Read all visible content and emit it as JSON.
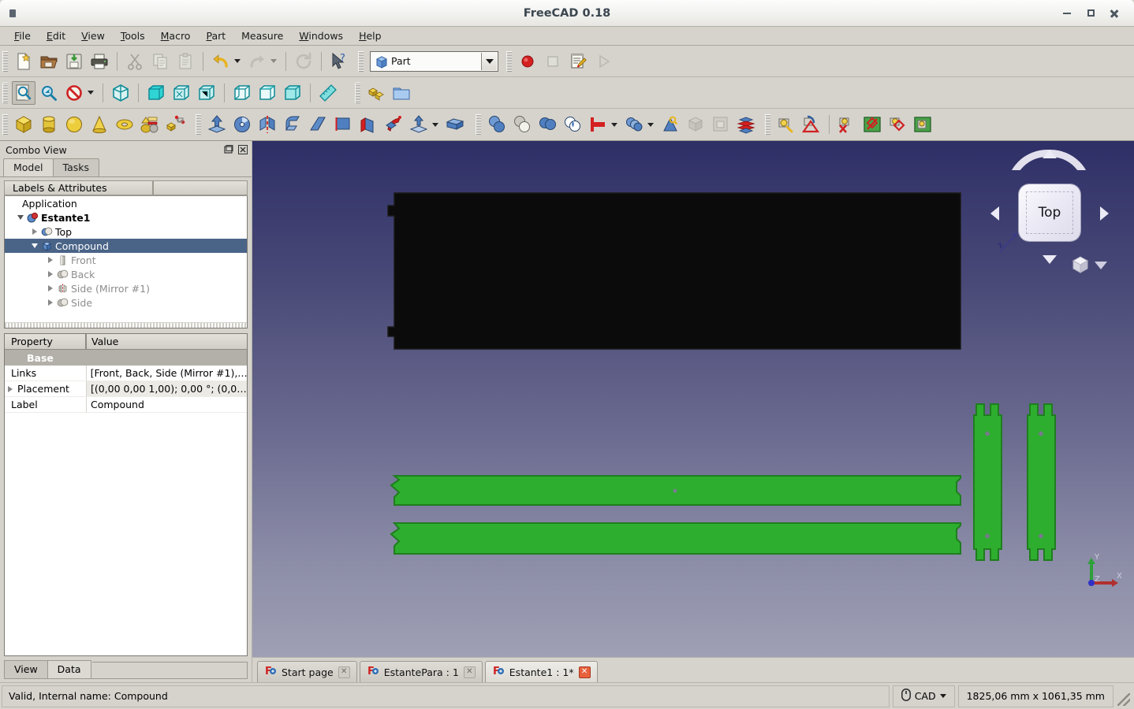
{
  "window": {
    "title": "FreeCAD 0.18",
    "minimize_label": "Minimize",
    "maximize_label": "Maximize",
    "close_label": "Close"
  },
  "menubar": {
    "items": [
      {
        "label": "File",
        "mnemonic": "F"
      },
      {
        "label": "Edit",
        "mnemonic": "E"
      },
      {
        "label": "View",
        "mnemonic": "V"
      },
      {
        "label": "Tools",
        "mnemonic": "T"
      },
      {
        "label": "Macro",
        "mnemonic": "M"
      },
      {
        "label": "Part",
        "mnemonic": "P"
      },
      {
        "label": "Measure",
        "mnemonic": ""
      },
      {
        "label": "Windows",
        "mnemonic": "W"
      },
      {
        "label": "Help",
        "mnemonic": "H"
      }
    ]
  },
  "toolbars": {
    "file": [
      {
        "name": "new-document-icon",
        "title": "New"
      },
      {
        "name": "open-document-icon",
        "title": "Open"
      },
      {
        "name": "save-document-icon",
        "title": "Save"
      },
      {
        "name": "print-icon",
        "title": "Print"
      },
      {
        "name": "cut-icon",
        "title": "Cut"
      },
      {
        "name": "copy-icon",
        "title": "Copy"
      },
      {
        "name": "paste-icon",
        "title": "Paste"
      },
      {
        "name": "undo-icon",
        "title": "Undo"
      },
      {
        "name": "redo-icon",
        "title": "Redo"
      },
      {
        "name": "refresh-icon",
        "title": "Refresh"
      },
      {
        "name": "whats-this-icon",
        "title": "What's this?"
      }
    ],
    "workbench": {
      "selected": "Part",
      "icon": "part-workbench-icon",
      "options": [
        "Part"
      ]
    },
    "macro": [
      {
        "name": "macro-record-icon",
        "title": "Macro recording"
      },
      {
        "name": "macro-stop-icon",
        "title": "Stop macro recording"
      },
      {
        "name": "macros-icon",
        "title": "Macros"
      },
      {
        "name": "macro-execute-icon",
        "title": "Execute macro"
      }
    ],
    "view": [
      {
        "name": "fit-all-icon",
        "title": "Fit all"
      },
      {
        "name": "fit-selection-icon",
        "title": "Fit selection"
      },
      {
        "name": "draw-style-icon",
        "title": "Draw style"
      },
      {
        "name": "isometric-view-icon",
        "title": "Axonometric"
      },
      {
        "name": "front-view-icon",
        "title": "Front"
      },
      {
        "name": "top-view-icon",
        "title": "Top"
      },
      {
        "name": "right-view-icon",
        "title": "Right"
      },
      {
        "name": "rear-view-icon",
        "title": "Rear"
      },
      {
        "name": "bottom-view-icon",
        "title": "Bottom"
      },
      {
        "name": "left-view-icon",
        "title": "Left"
      },
      {
        "name": "measure-icon",
        "title": "Measure"
      }
    ],
    "structure": [
      {
        "name": "create-part-icon",
        "title": "Create part"
      },
      {
        "name": "create-group-icon",
        "title": "Create group"
      }
    ],
    "primitives": [
      {
        "name": "box-icon",
        "title": "Cube"
      },
      {
        "name": "cylinder-icon",
        "title": "Cylinder"
      },
      {
        "name": "sphere-icon",
        "title": "Sphere"
      },
      {
        "name": "cone-icon",
        "title": "Cone"
      },
      {
        "name": "torus-icon",
        "title": "Torus"
      },
      {
        "name": "primitives-icon",
        "title": "Create primitives"
      },
      {
        "name": "shape-builder-icon",
        "title": "Shape builder"
      }
    ],
    "part_tools": [
      {
        "name": "extrude-icon",
        "title": "Extrude"
      },
      {
        "name": "revolve-icon",
        "title": "Revolve"
      },
      {
        "name": "mirror-icon",
        "title": "Mirror"
      },
      {
        "name": "fillet-icon",
        "title": "Fillet"
      },
      {
        "name": "chamfer-icon",
        "title": "Chamfer"
      },
      {
        "name": "ruled-surface-icon",
        "title": "Ruled surface"
      },
      {
        "name": "loft-icon",
        "title": "Loft"
      },
      {
        "name": "sweep-icon",
        "title": "Sweep"
      },
      {
        "name": "section-icon",
        "title": "Section"
      },
      {
        "name": "offset-icon",
        "title": "3D offset"
      },
      {
        "name": "thickness-icon",
        "title": "Thickness"
      }
    ],
    "boolean": [
      {
        "name": "boolean-icon",
        "title": "Boolean"
      },
      {
        "name": "cut-shape-icon",
        "title": "Cut"
      },
      {
        "name": "union-icon",
        "title": "Union"
      },
      {
        "name": "common-icon",
        "title": "Intersection"
      },
      {
        "name": "join-connect-icon",
        "title": "Join objects"
      },
      {
        "name": "split-icon",
        "title": "Split objects"
      },
      {
        "name": "compound-filter-icon",
        "title": "Compound filter"
      },
      {
        "name": "check-geometry-icon",
        "title": "Check geometry"
      },
      {
        "name": "defeaturing-icon",
        "title": "Defeaturing"
      },
      {
        "name": "cross-sections-icon",
        "title": "Cross-sections"
      }
    ],
    "measure": [
      {
        "name": "measure-linear-icon",
        "title": "Measure linear"
      },
      {
        "name": "measure-angular-icon",
        "title": "Measure angular"
      },
      {
        "name": "measure-refresh-icon",
        "title": "Refresh measure"
      },
      {
        "name": "measure-clear-all-icon",
        "title": "Clear all"
      },
      {
        "name": "measure-toggle-all-icon",
        "title": "Toggle all"
      },
      {
        "name": "measure-toggle-3d-icon",
        "title": "Toggle 3D"
      },
      {
        "name": "measure-toggle-delta-icon",
        "title": "Toggle delta"
      }
    ]
  },
  "combo_view": {
    "title": "Combo View",
    "float_button": "float-panel-icon",
    "close_button": "close-panel-icon",
    "tabs": [
      {
        "label": "Model",
        "active": true
      },
      {
        "label": "Tasks",
        "active": false
      }
    ],
    "tree_header": "Labels & Attributes",
    "tree": [
      {
        "label": "Application",
        "indent": 0,
        "icon": "",
        "expander": "none",
        "state": "normal"
      },
      {
        "label": "Estante1",
        "indent": 1,
        "icon": "document-icon",
        "expander": "open",
        "state": "bold"
      },
      {
        "label": "Top",
        "indent": 2,
        "icon": "fusion-icon",
        "expander": "closed",
        "state": "normal"
      },
      {
        "label": "Compound",
        "indent": 2,
        "icon": "compound-icon",
        "expander": "open",
        "state": "selected"
      },
      {
        "label": "Front",
        "indent": 3,
        "icon": "extrude-shape-icon",
        "expander": "closed",
        "state": "dim"
      },
      {
        "label": "Back",
        "indent": 3,
        "icon": "fusion-icon",
        "expander": "closed",
        "state": "dim"
      },
      {
        "label": "Side (Mirror #1)",
        "indent": 3,
        "icon": "mirror-shape-icon",
        "expander": "closed",
        "state": "dim"
      },
      {
        "label": "Side",
        "indent": 3,
        "icon": "fusion-icon",
        "expander": "closed",
        "state": "dim"
      }
    ],
    "property_editor": {
      "columns": [
        "Property",
        "Value"
      ],
      "groups": [
        {
          "name": "Base",
          "rows": [
            {
              "property": "Links",
              "value": "[Front, Back, Side (Mirror #1),…",
              "expandable": false
            },
            {
              "property": "Placement",
              "value": "[(0,00 0,00 1,00); 0,00 °; (0,0…",
              "expandable": true
            },
            {
              "property": "Label",
              "value": "Compound",
              "expandable": false
            }
          ]
        }
      ]
    },
    "bottom_tabs": [
      {
        "label": "View",
        "active": false
      },
      {
        "label": "Data",
        "active": true
      }
    ]
  },
  "view3d": {
    "nav_cube": {
      "face_label": "Top",
      "axis_labels": [
        "z"
      ],
      "left_arrow": "nav-arrow-left",
      "right_arrow": "nav-arrow-right",
      "up_arrow": "nav-arrow-up",
      "down_arrow": "nav-arrow-down",
      "corner_cube": "nav-corner-cube-icon",
      "corner_caret": "nav-corner-caret-icon"
    },
    "axis_indicator": {
      "x_label": "X",
      "y_label": "Y",
      "z_label": "Z",
      "x_color": "#b03030",
      "y_color": "#2fa03a",
      "z_color": "#3030c8"
    },
    "colors": {
      "background_top": "#2e2f66",
      "background_bottom": "#9fa0b5",
      "shelf_body": "#0b0b0b",
      "part_green": "#2eae2e",
      "part_green_edge": "#1f7d1f"
    },
    "objects": [
      {
        "name": "top-shelf-panel",
        "color": "#0b0b0b"
      },
      {
        "name": "shelf-board-upper",
        "color": "#2eae2e"
      },
      {
        "name": "shelf-board-lower",
        "color": "#2eae2e"
      },
      {
        "name": "side-panel-left",
        "color": "#2eae2e"
      },
      {
        "name": "side-panel-right",
        "color": "#2eae2e"
      }
    ]
  },
  "mdi_tabs": [
    {
      "label": "Start page",
      "icon": "freecad-doc-icon",
      "active": false,
      "close_style": "normal"
    },
    {
      "label": "EstantePara : 1",
      "icon": "freecad-doc-icon",
      "active": false,
      "close_style": "normal"
    },
    {
      "label": "Estante1 : 1*",
      "icon": "freecad-doc-icon",
      "active": true,
      "close_style": "red"
    }
  ],
  "statusbar": {
    "message": "Valid, Internal name: Compound",
    "nav_style_icon": "mouse-icon",
    "nav_style": "CAD",
    "dimensions": "1825,06 mm x 1061,35 mm"
  }
}
